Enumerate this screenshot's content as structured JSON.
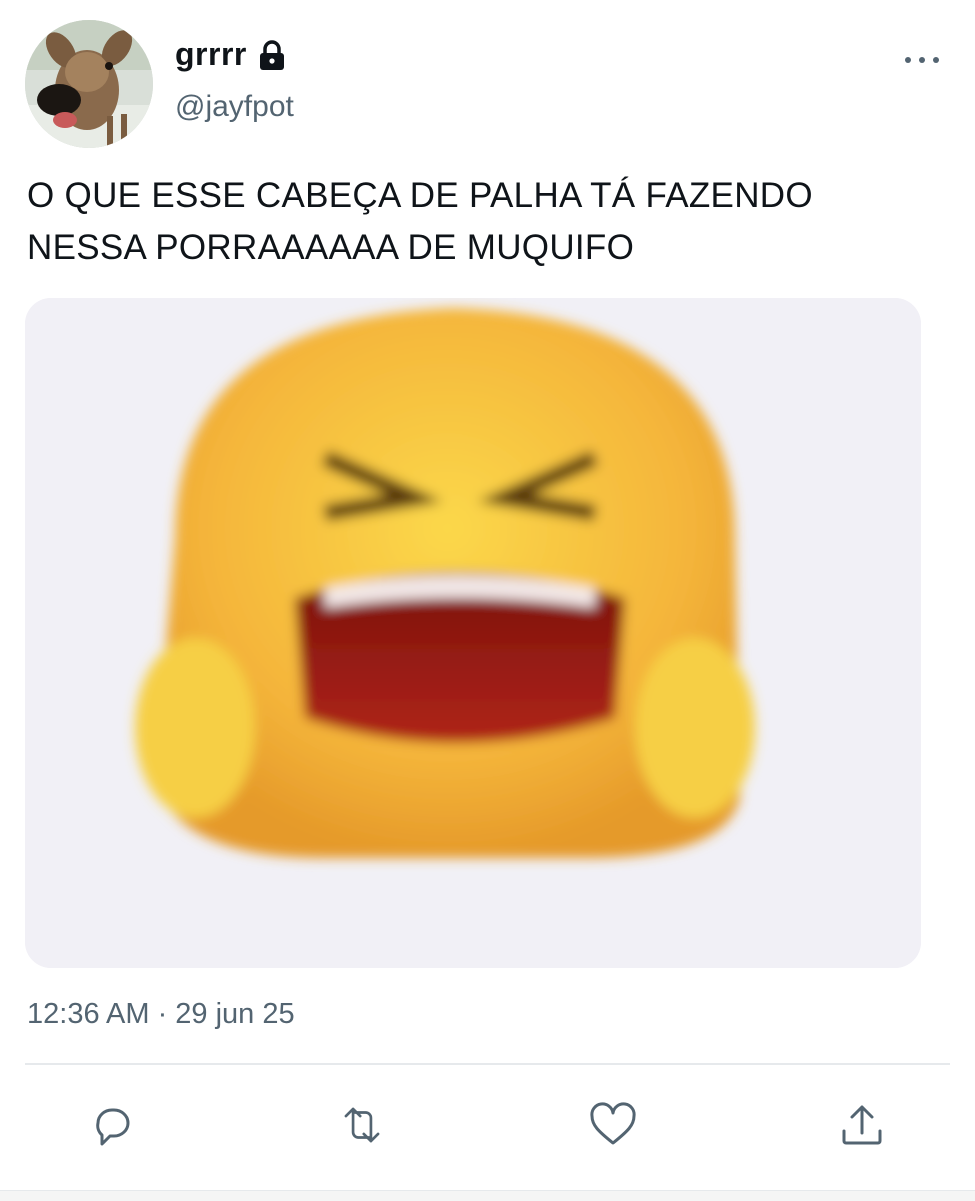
{
  "tweet": {
    "author": {
      "display_name": "grrrr",
      "handle": "@jayfpot",
      "protected_icon": "lock-icon",
      "avatar": "deer-photo"
    },
    "text_lines": [
      "O QUE ESSE CABEÇA DE PALHA TÁ FAZENDO",
      "NESSA PORRAAAAAA DE MUQUIFO"
    ],
    "media": {
      "description_icon": "laughing-emoji",
      "colors": {
        "background": "#f1f0f6",
        "face": "#f4b43a",
        "mouth": "#9a1c12"
      }
    },
    "timestamp": "12:36 AM · 29 jun 25",
    "actions": [
      {
        "icon": "reply-icon"
      },
      {
        "icon": "retweet-icon"
      },
      {
        "icon": "like-icon"
      },
      {
        "icon": "share-icon"
      }
    ],
    "more_icon": "more-options-icon"
  },
  "colors": {
    "text_primary": "#0f1419",
    "text_secondary": "#536471",
    "divider": "#e6e9ec"
  }
}
